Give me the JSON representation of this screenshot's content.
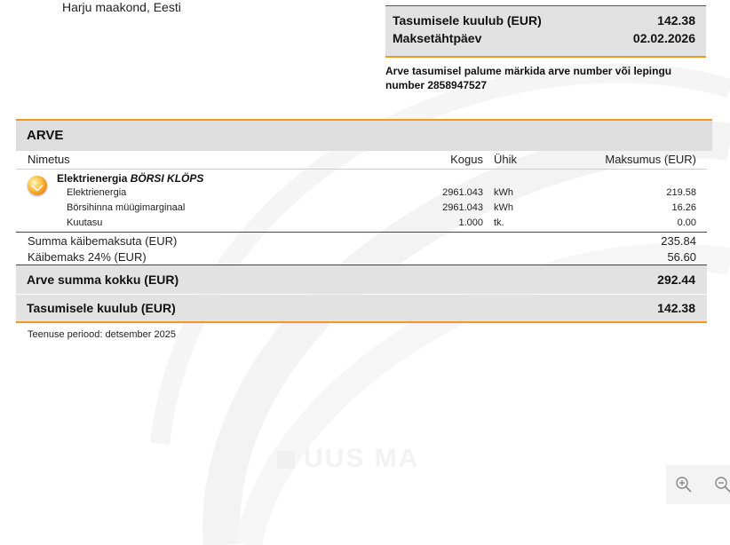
{
  "address": {
    "line": "Harju maakond, Eesti"
  },
  "payment": {
    "due_label": "Tasumisele kuulub (EUR)",
    "due_value": "142.38",
    "date_label": "Maksetähtpäev",
    "date_value": "02.02.2026",
    "note": "Arve tasumisel palume märkida arve number või lepingu number 2858947527"
  },
  "invoice": {
    "title": "ARVE",
    "columns": {
      "name": "Nimetus",
      "quantity": "Kogus",
      "unit": "Ühik",
      "cost": "Maksumus (EUR)"
    },
    "product": {
      "name": "Elektrienergia",
      "plan": "BÖRSI KLÖPS",
      "icon": "electricity-plan-icon"
    },
    "items": [
      {
        "name": "Elektrienergia",
        "quantity": "2961.043",
        "unit": "kWh",
        "cost": "219.58"
      },
      {
        "name": "Börsihinna müügimarginaal",
        "quantity": "2961.043",
        "unit": "kWh",
        "cost": "16.26"
      },
      {
        "name": "Kuutasu",
        "quantity": "1.000",
        "unit": "tk.",
        "cost": "0.00"
      }
    ],
    "subtotal_label": "Summa käibemaksuta (EUR)",
    "subtotal_value": "235.84",
    "vat_label": "Käibemaks 24% (EUR)",
    "vat_value": "56.60",
    "total_label": "Arve summa kokku (EUR)",
    "total_value": "292.44",
    "due_label": "Tasumisele kuulub (EUR)",
    "due_value": "142.38",
    "service_period": "Teenuse periood: detsember 2025"
  },
  "watermark": {
    "text": "UUS MA"
  },
  "viewer": {
    "zoom_in_icon": "zoom-in-icon",
    "zoom_out_icon": "zoom-out-icon"
  },
  "colors": {
    "accent": "#f39a1e",
    "panel": "#e2e2e2",
    "header": "#dedede"
  }
}
